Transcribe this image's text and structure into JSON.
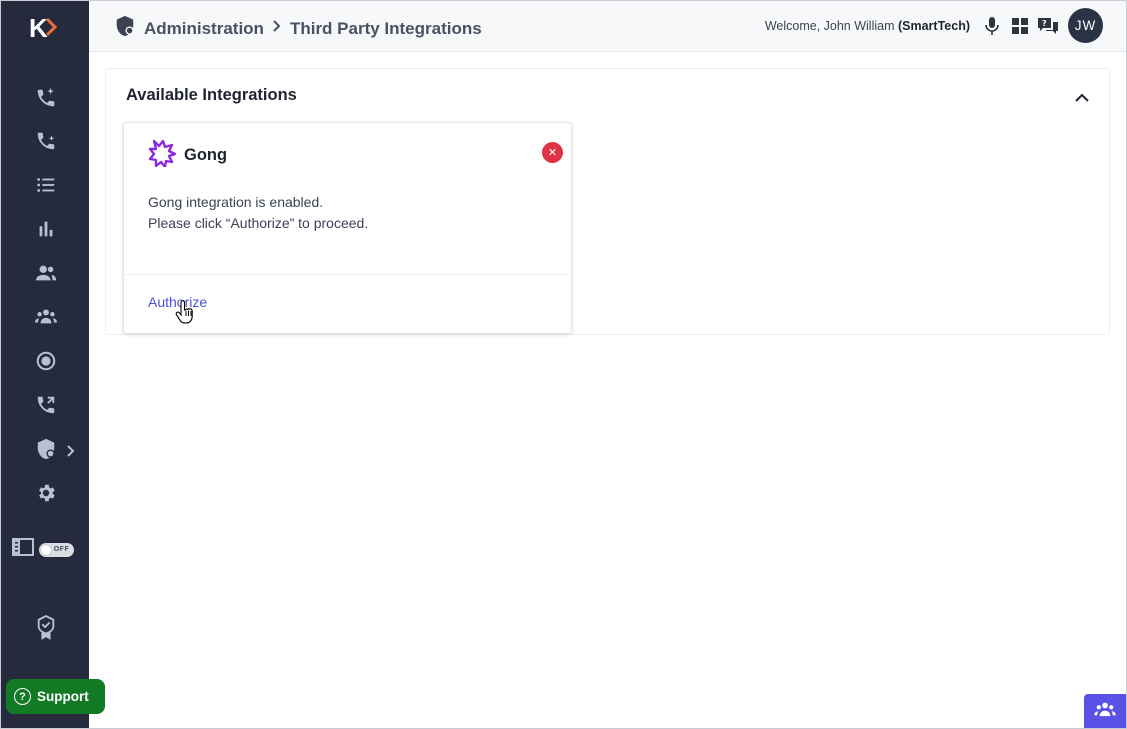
{
  "brand": {
    "logo_letter": "K"
  },
  "sidebar": {
    "items": [
      {
        "name": "ai-call-icon"
      },
      {
        "name": "call-sparkle-icon"
      },
      {
        "name": "list-icon"
      },
      {
        "name": "bar-chart-icon"
      },
      {
        "name": "users-icon"
      },
      {
        "name": "groups-icon"
      },
      {
        "name": "record-icon"
      },
      {
        "name": "call-forward-icon"
      },
      {
        "name": "admin-shield-icon"
      },
      {
        "name": "gear-icon"
      }
    ],
    "toggle_label": "OFF"
  },
  "support": {
    "label": "Support"
  },
  "header": {
    "breadcrumb": [
      "Administration",
      "Third Party Integrations"
    ],
    "welcome_prefix": "Welcome, John William ",
    "org": "(SmartTech)",
    "avatar_initials": "JW"
  },
  "panel": {
    "title": "Available Integrations",
    "card": {
      "name": "Gong",
      "close_symbol": "✕",
      "line1": "Gong integration is enabled.",
      "line2": "Please click “Authorize” to proceed.",
      "action": "Authorize"
    }
  },
  "colors": {
    "sidebar_bg": "#252a3d",
    "accent": "#4b4fd8",
    "support_green": "#127a25",
    "close_red": "#e03444",
    "gong_purple": "#8a2be2"
  }
}
